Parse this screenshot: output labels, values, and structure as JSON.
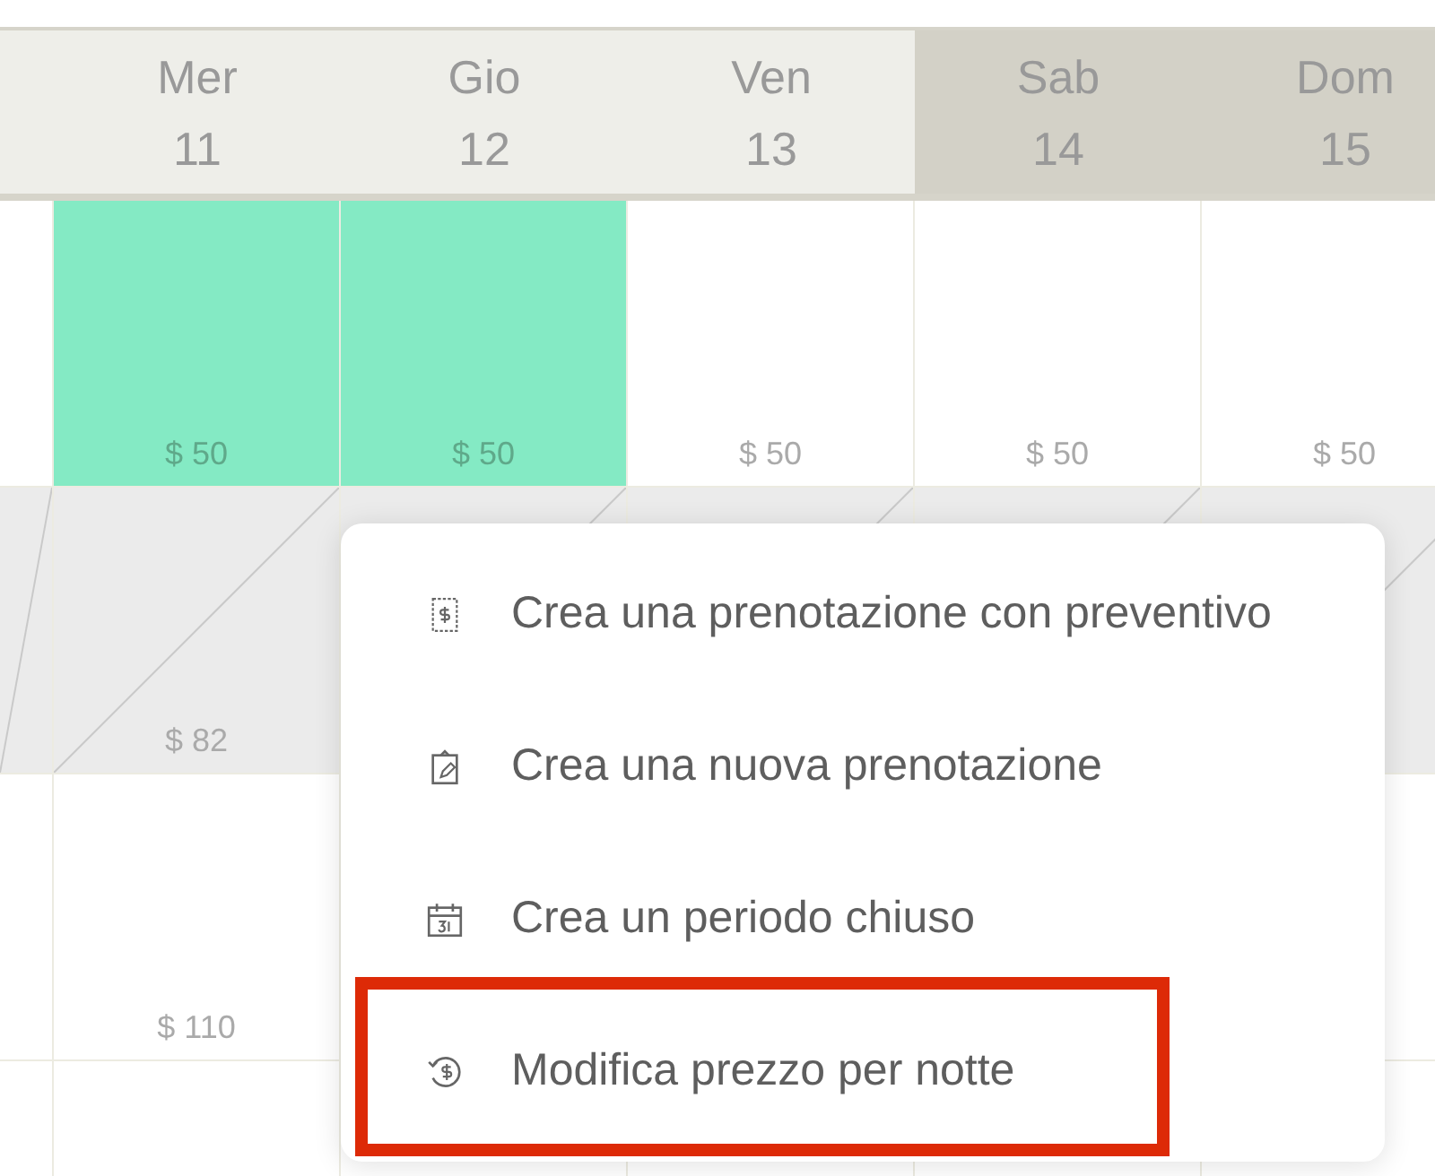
{
  "days": [
    {
      "weekend": false
    },
    {
      "weekday": "Mer",
      "date": "11",
      "weekend": false
    },
    {
      "weekday": "Gio",
      "date": "12",
      "weekend": false
    },
    {
      "weekday": "Ven",
      "date": "13",
      "weekend": false
    },
    {
      "weekday": "Sab",
      "date": "14",
      "weekend": true
    },
    {
      "weekday": "Dom",
      "date": "15",
      "weekend": true
    }
  ],
  "rows": [
    {
      "blocked": false,
      "cells": [
        {
          "booked": false
        },
        {
          "booked": true,
          "price": "$ 50"
        },
        {
          "booked": true,
          "price": "$ 50"
        },
        {
          "booked": false,
          "price": "$ 50"
        },
        {
          "booked": false,
          "price": "$ 50"
        },
        {
          "booked": false,
          "price": "$ 50"
        }
      ]
    },
    {
      "blocked": true,
      "cells": [
        {
          "booked": false
        },
        {
          "booked": false,
          "price": "$ 82"
        },
        {
          "booked": false
        },
        {
          "booked": false
        },
        {
          "booked": false
        },
        {
          "booked": false
        }
      ]
    },
    {
      "blocked": false,
      "cells": [
        {
          "booked": false
        },
        {
          "booked": false,
          "price": "$ 110"
        },
        {},
        {},
        {},
        {
          "booked": false
        }
      ]
    },
    {
      "blocked": false,
      "cells": [
        {
          "booked": false
        },
        {
          "booked": false
        },
        {
          "booked": false
        },
        {
          "booked": false
        },
        {
          "booked": false
        },
        {}
      ]
    }
  ],
  "context_menu": {
    "items": [
      {
        "kind": "quote",
        "label": "Crea una prenotazione con preventivo",
        "highlighted": false
      },
      {
        "kind": "booking",
        "label": "Crea una nuova prenotazione",
        "highlighted": false
      },
      {
        "kind": "closed",
        "label": "Crea un periodo chiuso",
        "highlighted": false
      },
      {
        "kind": "price",
        "label": "Modifica prezzo per notte",
        "highlighted": true
      }
    ]
  }
}
